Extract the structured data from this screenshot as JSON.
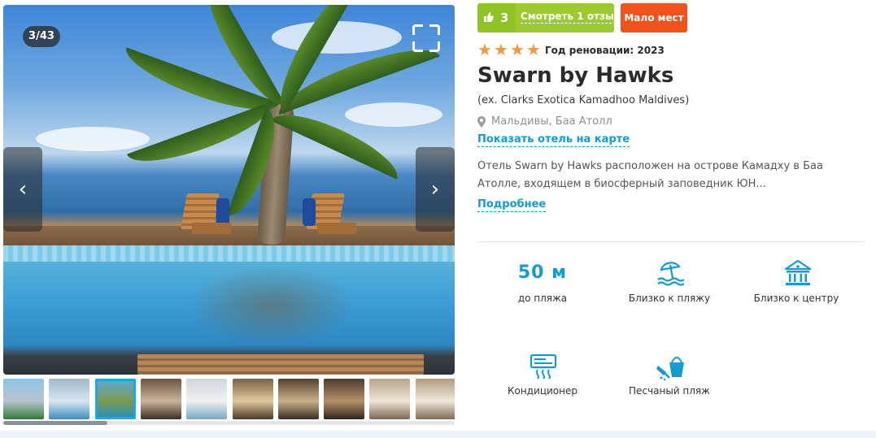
{
  "gallery": {
    "counter": "3/43",
    "prev_icon": "chevron-left-icon",
    "next_icon": "chevron-right-icon",
    "fullscreen_icon": "fullscreen-icon",
    "thumbnails": [
      {
        "colors": [
          "#8cc4e8",
          "#b9c3cc",
          "#2f7d3a"
        ]
      },
      {
        "colors": [
          "#9fb9c9",
          "#d7e6ef",
          "#3c8fc2"
        ]
      },
      {
        "colors": [
          "#5fa9dd",
          "#7b9a50",
          "#1f8ec3"
        ]
      },
      {
        "colors": [
          "#6b5440",
          "#c9b399",
          "#3d2e22"
        ]
      },
      {
        "colors": [
          "#cfd7dc",
          "#f1f1f1",
          "#76a7c4"
        ]
      },
      {
        "colors": [
          "#7c6146",
          "#e0c89d",
          "#4a3829"
        ]
      },
      {
        "colors": [
          "#57412f",
          "#c8b089",
          "#3c2d20"
        ]
      },
      {
        "colors": [
          "#4e3b2d",
          "#b5916a",
          "#2f241b"
        ]
      },
      {
        "colors": [
          "#b9a58a",
          "#efe6d8",
          "#7c6650"
        ]
      },
      {
        "colors": [
          "#b39b7e",
          "#f0e8dc",
          "#826a52"
        ]
      }
    ],
    "active_thumbnail": 2,
    "scroll_fraction": 0.23
  },
  "badges": {
    "likes": "3",
    "likes_icon": "thumbs-up-icon",
    "reviews": "Смотреть 1 отзыв",
    "availability": "Мало мест"
  },
  "hotel": {
    "stars": 4,
    "renovation": "Год реновации: 2023",
    "name": "Swarn by Hawks",
    "former_name": "(ex. Clarks Exotica Kamadhoo Maldives)",
    "location_icon": "map-pin-icon",
    "location": "Мальдивы, Баа Атолл",
    "map_link": "Показать отель на карте",
    "description": "Отель Swarn by Hawks расположен на острове Камадху в Баа Атолле, входящем в биосферный заповедник ЮН...",
    "more_link": "Подробнее"
  },
  "features": [
    {
      "value": "50 м",
      "label": "до пляжа"
    },
    {
      "icon": "beach-umbrella-icon",
      "label": "Близко к пляжу"
    },
    {
      "icon": "building-center-icon",
      "label": "Близко к центру"
    },
    {
      "icon": "air-conditioner-icon",
      "label": "Кондиционер"
    },
    {
      "icon": "sand-bucket-icon",
      "label": "Песчаный пляж"
    }
  ],
  "colors": {
    "accent": "#139bd4",
    "likes_green": "#8fc425",
    "alert_orange": "#f2521c",
    "star": "#f59a3c"
  }
}
